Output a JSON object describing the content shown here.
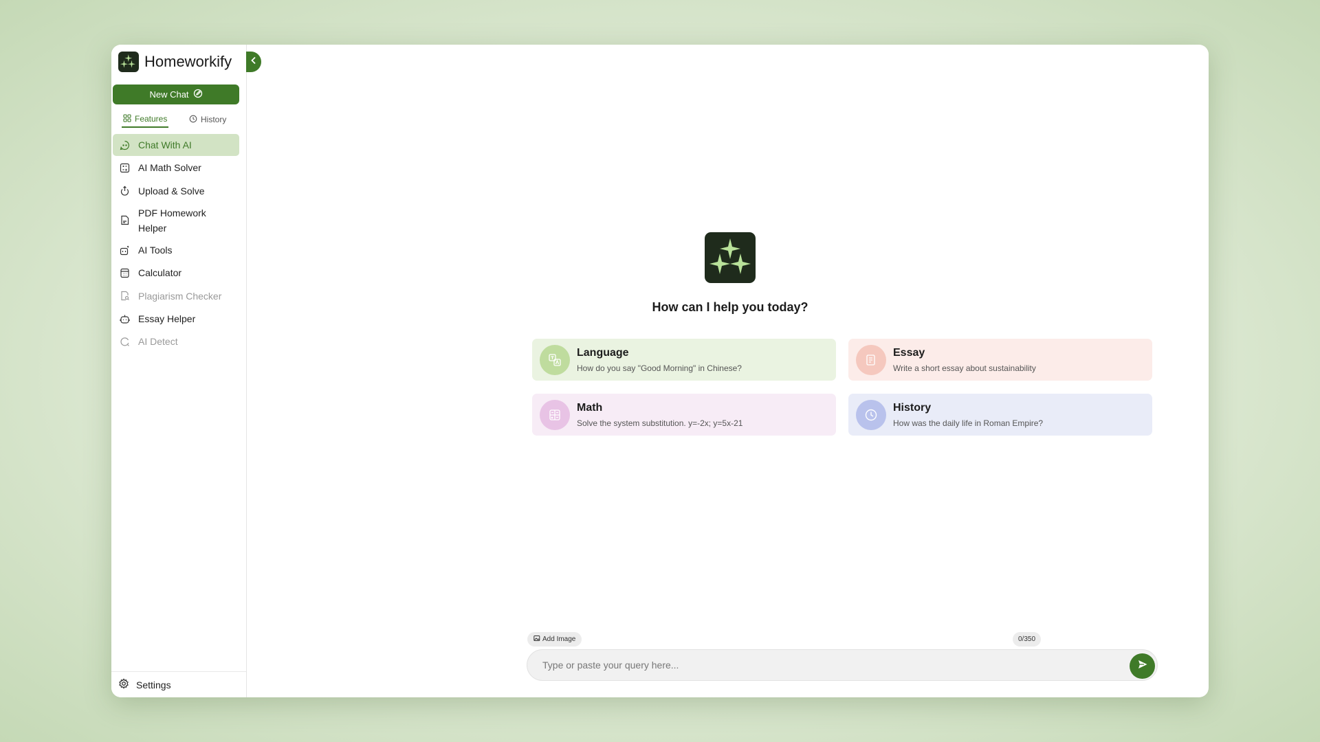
{
  "app": {
    "name": "Homeworkify"
  },
  "sidebar": {
    "new_chat_label": "New Chat",
    "tabs": [
      {
        "label": "Features",
        "icon": "grid-icon",
        "active": true
      },
      {
        "label": "History",
        "icon": "clock-icon",
        "active": false
      }
    ],
    "items": [
      {
        "label": "Chat With AI",
        "icon": "chat-icon",
        "active": true
      },
      {
        "label": "AI Math Solver",
        "icon": "calculator-grid-icon"
      },
      {
        "label": "Upload & Solve",
        "icon": "upload-icon"
      },
      {
        "label": "PDF Homework Helper",
        "icon": "pdf-icon"
      },
      {
        "label": "AI Tools",
        "icon": "tools-icon"
      },
      {
        "label": "Calculator",
        "icon": "calculator-icon"
      },
      {
        "label": "Plagiarism Checker",
        "icon": "document-search-icon",
        "muted": true
      },
      {
        "label": "Essay Helper",
        "icon": "robot-icon"
      },
      {
        "label": "AI Detect",
        "icon": "detect-icon",
        "muted": true
      }
    ],
    "settings_label": "Settings"
  },
  "main": {
    "greeting": "How can I help you today?",
    "cards": [
      {
        "title": "Language",
        "desc": "How do you say \"Good Morning\" in Chinese?",
        "icon": "translate-icon",
        "color": "#eaf3e1"
      },
      {
        "title": "Essay",
        "desc": "Write a short essay about sustainability",
        "icon": "pen-icon",
        "color": "#fcece9"
      },
      {
        "title": "Math",
        "desc": "Solve the system substitution. y=-2x; y=5x-21",
        "icon": "math-icon",
        "color": "#f7ecf6"
      },
      {
        "title": "History",
        "desc": "How was the daily life in Roman Empire?",
        "icon": "clock-icon",
        "color": "#e9ecf8"
      }
    ],
    "composer": {
      "add_image_label": "Add Image",
      "counter": "0/350",
      "placeholder": "Type or paste your query here..."
    }
  },
  "colors": {
    "accent": "#3f7a28",
    "logo_bg": "#1f2b1c",
    "active_bg": "#d2e3c4"
  }
}
